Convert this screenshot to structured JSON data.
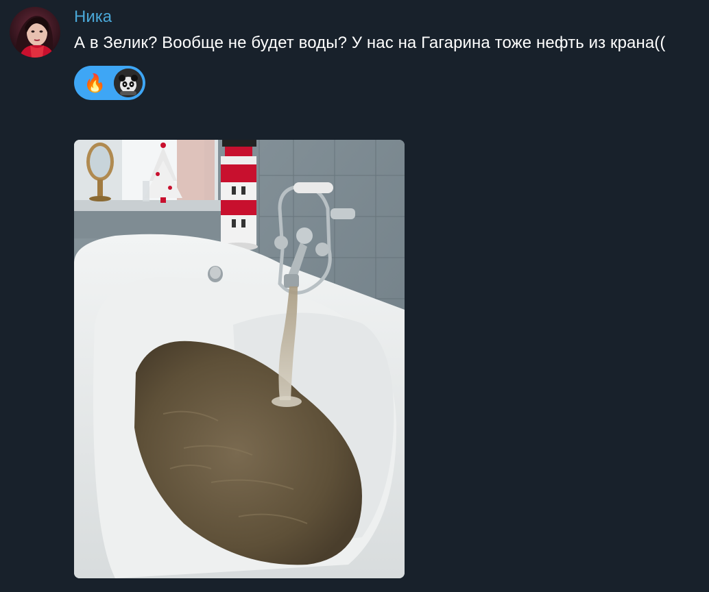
{
  "message": {
    "sender": "Ника",
    "text": "А в Зелик? Вообще не будет воды? У нас на Гагарина тоже нефть из крана((",
    "avatar_icon": "user-avatar-photo",
    "reactions": [
      {
        "emoji": "🔥",
        "icon": "fire-icon"
      }
    ],
    "reactor_avatar_icon": "reactor-avatar-panda",
    "photo_icon": "bathtub-photo"
  },
  "colors": {
    "background": "#18212b",
    "sender_name": "#4aa8d8",
    "text": "#ffffff",
    "reaction_pill": "#3ea6f5"
  }
}
